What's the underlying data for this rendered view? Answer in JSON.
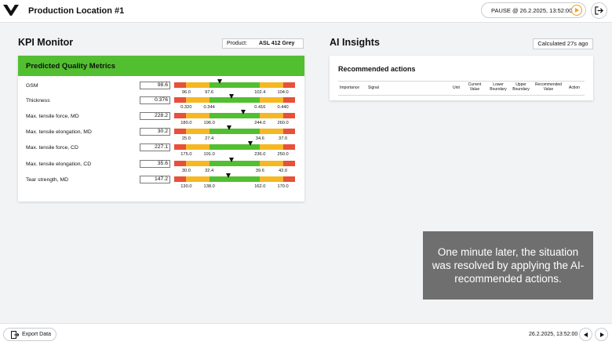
{
  "header": {
    "title": "Production Location #1",
    "status": "PAUSE @ 26.2.2025, 13:52:00",
    "play_icon": "play-icon",
    "logout_icon": "logout-icon"
  },
  "kpi": {
    "title": "KPI Monitor",
    "product_label": "Product:",
    "product_value": "ASL 412 Grey",
    "card_title": "Predicted Quality Metrics",
    "colors": {
      "red": "#e8503a",
      "yellow": "#f5b823",
      "green": "#52bf30"
    },
    "metrics": [
      {
        "name": "GSM",
        "value": "98.6",
        "ticks": [
          "96.0",
          "97.6",
          "102.4",
          "104.0"
        ]
      },
      {
        "name": "Thickness",
        "value": "0.376",
        "ticks": [
          "0.320",
          "0.344",
          "0.416",
          "0.440"
        ]
      },
      {
        "name": "Max. tensile force, MD",
        "value": "228.2",
        "ticks": [
          "180.0",
          "196.0",
          "244.0",
          "260.0"
        ]
      },
      {
        "name": "Max. tensile elongation, MD",
        "value": "30.2",
        "ticks": [
          "25.0",
          "27.4",
          "34.6",
          "37.0"
        ]
      },
      {
        "name": "Max. tensile force, CD",
        "value": "227.1",
        "ticks": [
          "175.0",
          "191.0",
          "236.0",
          "250.0"
        ]
      },
      {
        "name": "Max. tensile elongation, CD",
        "value": "35.6",
        "ticks": [
          "30.0",
          "32.4",
          "39.6",
          "42.0"
        ]
      },
      {
        "name": "Tear strength, MD",
        "value": "147.2",
        "ticks": [
          "130.0",
          "138.0",
          "162.0",
          "170.0"
        ]
      }
    ]
  },
  "ai": {
    "title": "AI Insights",
    "calculated": "Calculated 27s ago",
    "card_title": "Recommended actions",
    "columns": [
      "Importance",
      "Signal",
      "Unit",
      "Current Value",
      "Lower Boundary",
      "Upper Boundary",
      "Recommended Value",
      "Action"
    ]
  },
  "overlay": {
    "text": "One minute later, the situation was resolved by applying the AI-recommended actions."
  },
  "footer": {
    "export_label": "Export Data",
    "timestamp": "26.2.2025, 13:52:00"
  }
}
